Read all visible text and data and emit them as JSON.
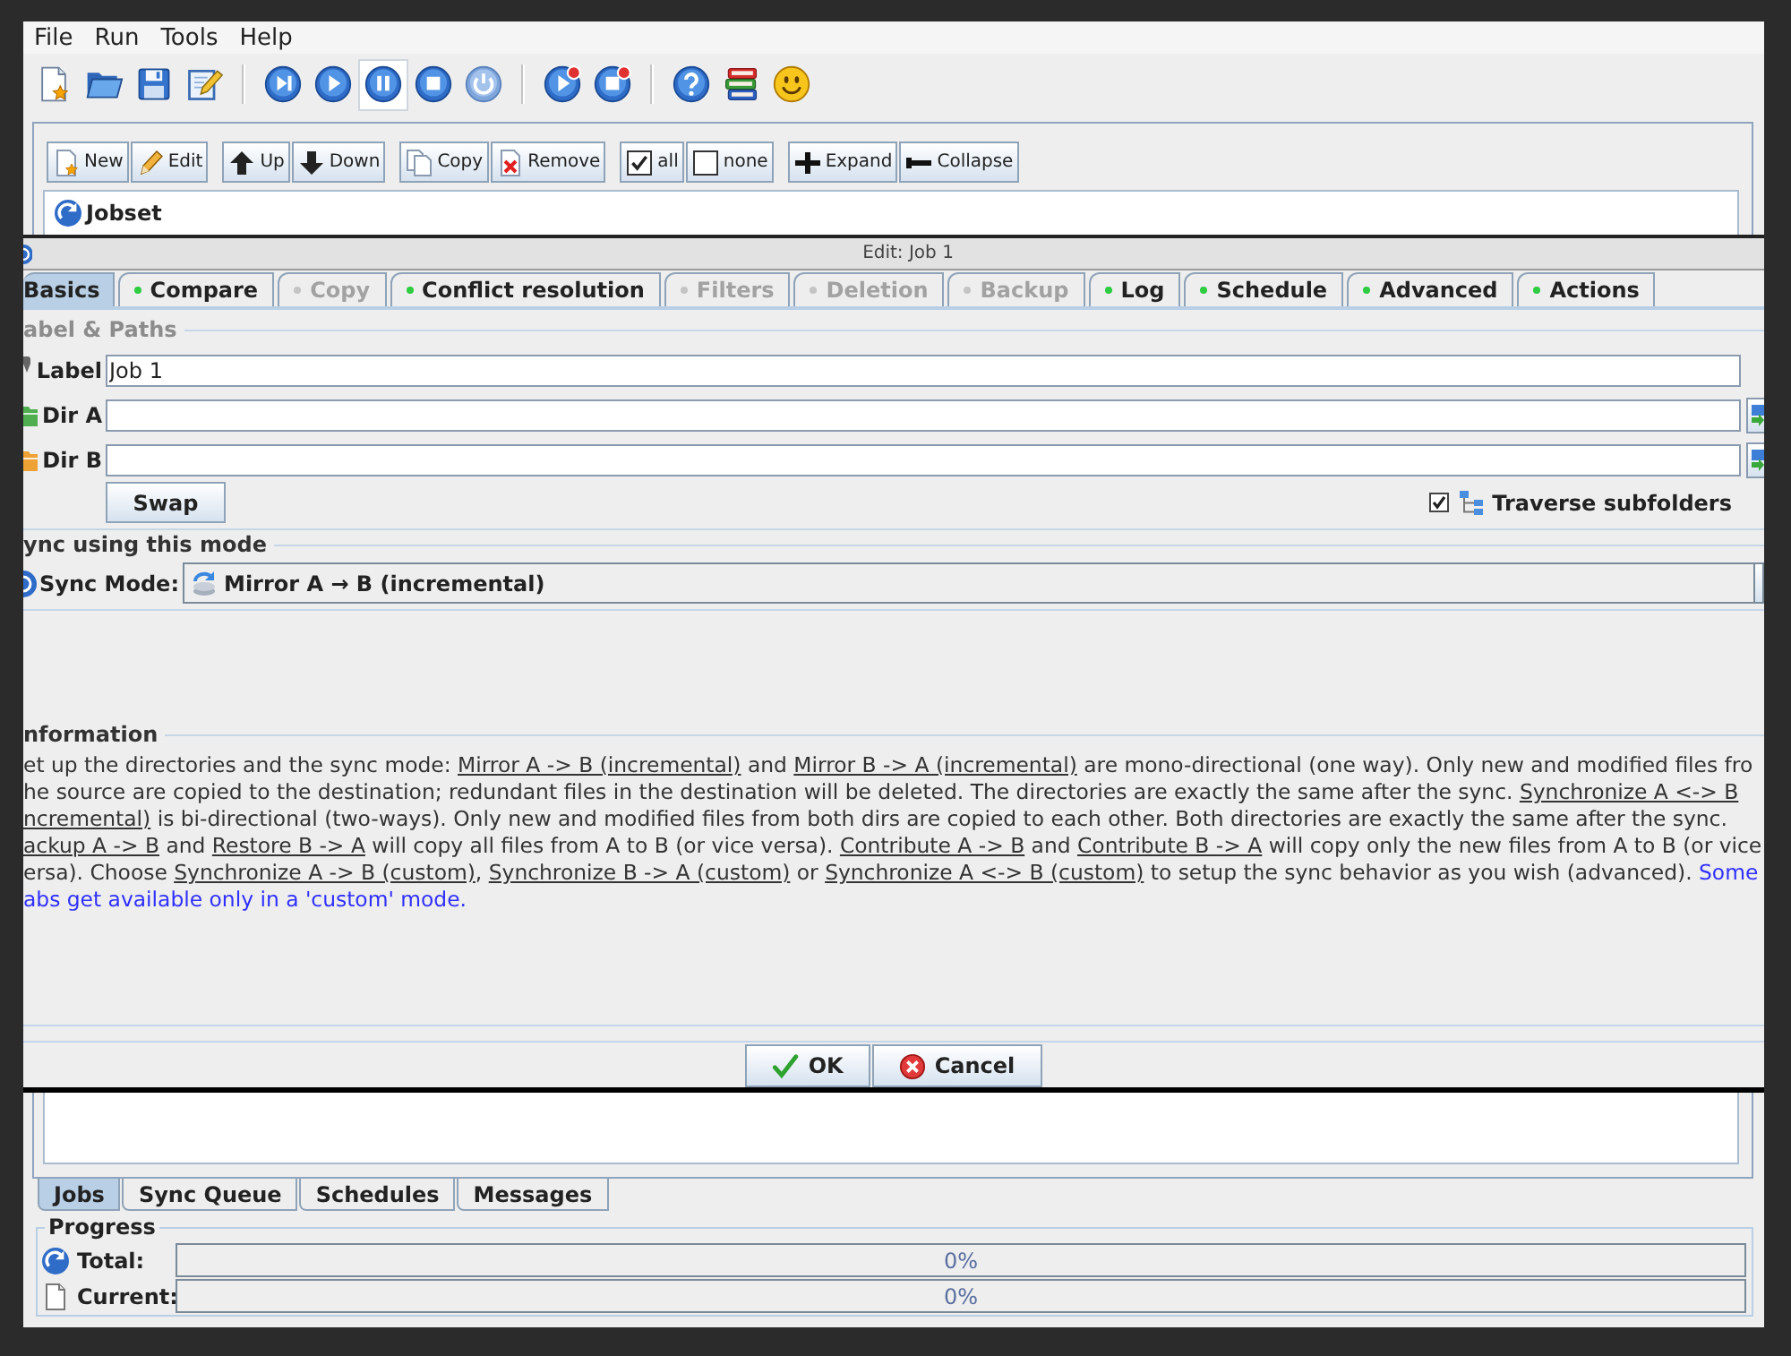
{
  "menu": [
    {
      "label": "File"
    },
    {
      "label": "Run"
    },
    {
      "label": "Tools"
    },
    {
      "label": "Help"
    }
  ],
  "toolbar": [
    [
      {
        "kind": "new",
        "hovered": false
      },
      {
        "kind": "open",
        "hovered": false
      },
      {
        "kind": "save",
        "hovered": false
      },
      {
        "kind": "edit",
        "hovered": false
      }
    ],
    [
      {
        "kind": "skip",
        "hovered": false
      },
      {
        "kind": "play",
        "hovered": false
      },
      {
        "kind": "pause",
        "hovered": true
      },
      {
        "kind": "stop",
        "hovered": false
      },
      {
        "kind": "power",
        "hovered": false
      }
    ],
    [
      {
        "kind": "playbadge",
        "hovered": false
      },
      {
        "kind": "stopbadge",
        "hovered": false
      }
    ],
    [
      {
        "kind": "help",
        "hovered": false
      },
      {
        "kind": "books",
        "hovered": false
      },
      {
        "kind": "smiley",
        "hovered": false
      }
    ]
  ],
  "job_buttons": [
    [
      {
        "kind": "new",
        "label": "New"
      },
      {
        "kind": "edit",
        "label": "Edit"
      }
    ],
    [
      {
        "kind": "up",
        "label": "Up"
      },
      {
        "kind": "down",
        "label": "Down"
      }
    ],
    [
      {
        "kind": "copy",
        "label": "Copy"
      },
      {
        "kind": "remove",
        "label": "Remove"
      }
    ],
    [
      {
        "kind": "all",
        "label": "all"
      },
      {
        "kind": "none",
        "label": "none"
      }
    ],
    [
      {
        "kind": "expand",
        "label": "Expand"
      },
      {
        "kind": "collapse",
        "label": "Collapse"
      }
    ]
  ],
  "tree": [
    {
      "label": "Jobset"
    }
  ],
  "dialog": {
    "title": "Edit: Job 1",
    "tabs": [
      {
        "label": "Basics",
        "selected": true,
        "enabled": true,
        "dot": false
      },
      {
        "label": "Compare",
        "selected": false,
        "enabled": true,
        "dot": true
      },
      {
        "label": "Copy",
        "selected": false,
        "enabled": false,
        "dot": true
      },
      {
        "label": "Conflict resolution",
        "selected": false,
        "enabled": true,
        "dot": true
      },
      {
        "label": "Filters",
        "selected": false,
        "enabled": false,
        "dot": true
      },
      {
        "label": "Deletion",
        "selected": false,
        "enabled": false,
        "dot": true
      },
      {
        "label": "Backup",
        "selected": false,
        "enabled": false,
        "dot": true
      },
      {
        "label": "Log",
        "selected": false,
        "enabled": true,
        "dot": true
      },
      {
        "label": "Schedule",
        "selected": false,
        "enabled": true,
        "dot": true
      },
      {
        "label": "Advanced",
        "selected": false,
        "enabled": true,
        "dot": true
      },
      {
        "label": "Actions",
        "selected": false,
        "enabled": true,
        "dot": true
      }
    ],
    "groups": [
      {
        "kind": "paths",
        "heading": "abel & Paths",
        "dimmed": true,
        "fields": [
          {
            "kind": "text",
            "label": "Label",
            "value": "Job 1"
          },
          {
            "kind": "directory",
            "label": "Dir A",
            "color": "#4fae4f"
          },
          {
            "kind": "directory",
            "label": "Dir B",
            "color": "#eea236"
          }
        ],
        "swap_button": "Swap",
        "traverse": {
          "label": "Traverse subfolders",
          "checked": true
        }
      },
      {
        "kind": "mode",
        "heading": "ync using this mode",
        "dimmed": false,
        "label": "Sync Mode:",
        "value": "Mirror A → B (incremental)"
      },
      {
        "kind": "info",
        "heading": "nformation",
        "dimmed": false,
        "lines": [
          [
            {
              "kind": "plain",
              "text": "et up the directories and the sync mode: "
            },
            {
              "kind": "link",
              "text": "Mirror A -> B (incremental)"
            },
            {
              "kind": "plain",
              "text": " and "
            },
            {
              "kind": "link",
              "text": "Mirror B -> A (incremental)"
            },
            {
              "kind": "plain",
              "text": " are mono-directional (one way). Only new and modified files fro"
            }
          ],
          [
            {
              "kind": "plain",
              "text": "he source are copied to the destination; redundant files in the destination will be deleted. The directories are exactly the same after the sync. "
            },
            {
              "kind": "link",
              "text": "Synchronize A <-> B"
            }
          ],
          [
            {
              "kind": "link",
              "text": "ncremental)"
            },
            {
              "kind": "plain",
              "text": " is bi-directional (two-ways). Only new and modified files from both dirs are copied to each other. Both directories are exactly the same after the sync."
            }
          ],
          [
            {
              "kind": "link",
              "text": "ackup A -> B"
            },
            {
              "kind": "plain",
              "text": " and "
            },
            {
              "kind": "link",
              "text": "Restore B -> A"
            },
            {
              "kind": "plain",
              "text": " will copy all files from A to B (or vice versa). "
            },
            {
              "kind": "link",
              "text": "Contribute A -> B"
            },
            {
              "kind": "plain",
              "text": " and "
            },
            {
              "kind": "link",
              "text": "Contribute B -> A"
            },
            {
              "kind": "plain",
              "text": " will copy only the new files from A to B (or vice"
            }
          ],
          [
            {
              "kind": "plain",
              "text": "ersa). Choose "
            },
            {
              "kind": "link",
              "text": "Synchronize A -> B (custom)"
            },
            {
              "kind": "plain",
              "text": ", "
            },
            {
              "kind": "link",
              "text": "Synchronize B -> A (custom)"
            },
            {
              "kind": "plain",
              "text": " or "
            },
            {
              "kind": "link",
              "text": "Synchronize A <-> B (custom)"
            },
            {
              "kind": "plain",
              "text": " to setup the sync behavior as you wish (advanced). "
            },
            {
              "kind": "note",
              "text": "Some"
            }
          ],
          [
            {
              "kind": "note",
              "text": "abs get available only in a 'custom' mode."
            }
          ]
        ]
      }
    ],
    "buttons": [
      {
        "kind": "ok",
        "label": "OK"
      },
      {
        "kind": "cancel",
        "label": "Cancel"
      }
    ]
  },
  "bottom_tabs": [
    {
      "label": "Jobs",
      "selected": true
    },
    {
      "label": "Sync Queue",
      "selected": false
    },
    {
      "label": "Schedules",
      "selected": false
    },
    {
      "label": "Messages",
      "selected": false
    }
  ],
  "progress": {
    "heading": "Progress",
    "bars": [
      {
        "kind": "total",
        "label": "Total:",
        "level": 0,
        "reading": "0%"
      },
      {
        "kind": "current",
        "label": "Current:",
        "level": 0,
        "reading": "0%"
      }
    ]
  }
}
